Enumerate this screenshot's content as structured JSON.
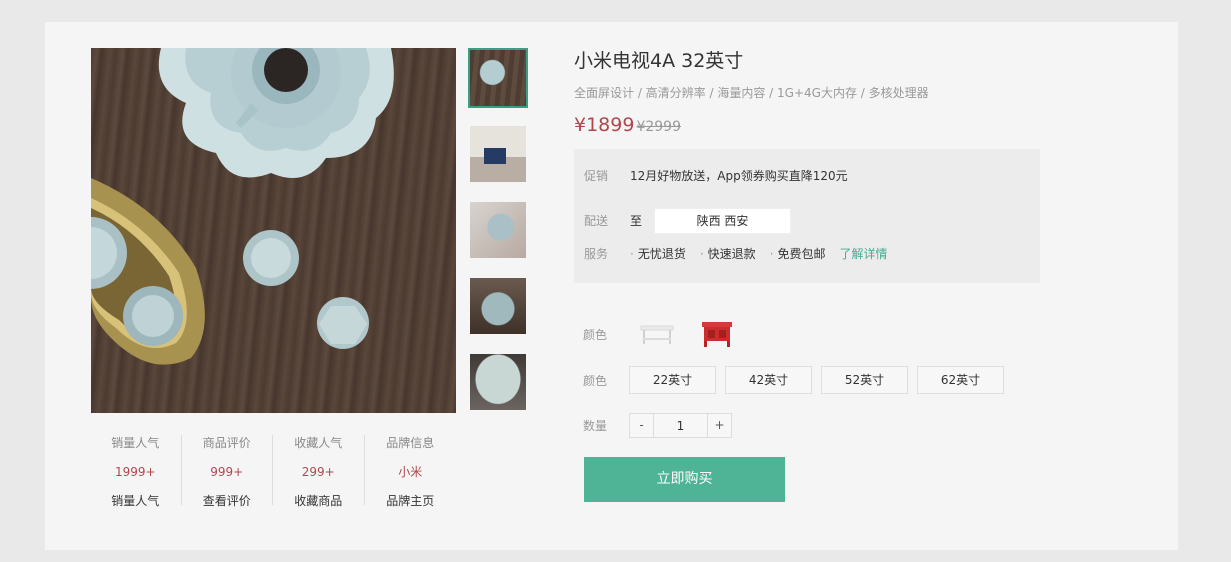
{
  "product": {
    "title": "小米电视4A 32英寸",
    "subtitle": "全面屏设计 / 高清分辨率 / 海量内容 / 1G+4G大内存 / 多核处理器",
    "price": "¥1899",
    "old_price": "¥2999"
  },
  "stats": [
    {
      "heading": "销量人气",
      "value": "1999+",
      "link": "销量人气"
    },
    {
      "heading": "商品评价",
      "value": "999+",
      "link": "查看评价"
    },
    {
      "heading": "收藏人气",
      "value": "299+",
      "link": "收藏商品"
    },
    {
      "heading": "品牌信息",
      "value": "小米",
      "link": "品牌主页"
    }
  ],
  "promo": {
    "promo_label": "促销",
    "promo_text": "12月好物放送，App领券购买直降120元",
    "delivery_label": "配送",
    "delivery_to": "至",
    "delivery_address": "陕西 西安",
    "service_label": "服务",
    "services": [
      "无忧退货",
      "快速退款",
      "免费包邮"
    ],
    "service_dot": "·",
    "details_link": "了解详情"
  },
  "options": {
    "color_label": "颜色",
    "size_label": "颜色",
    "sizes": [
      "22英寸",
      "42英寸",
      "52英寸",
      "62英寸"
    ],
    "quantity_label": "数量",
    "minus": "-",
    "quantity": "1",
    "plus": "+"
  },
  "buy_button": "立即购买",
  "colors": {
    "accent": "#4fb396",
    "price": "#b0474e",
    "link": "#3fae91",
    "active_thumb_border": "#3a9e84"
  }
}
